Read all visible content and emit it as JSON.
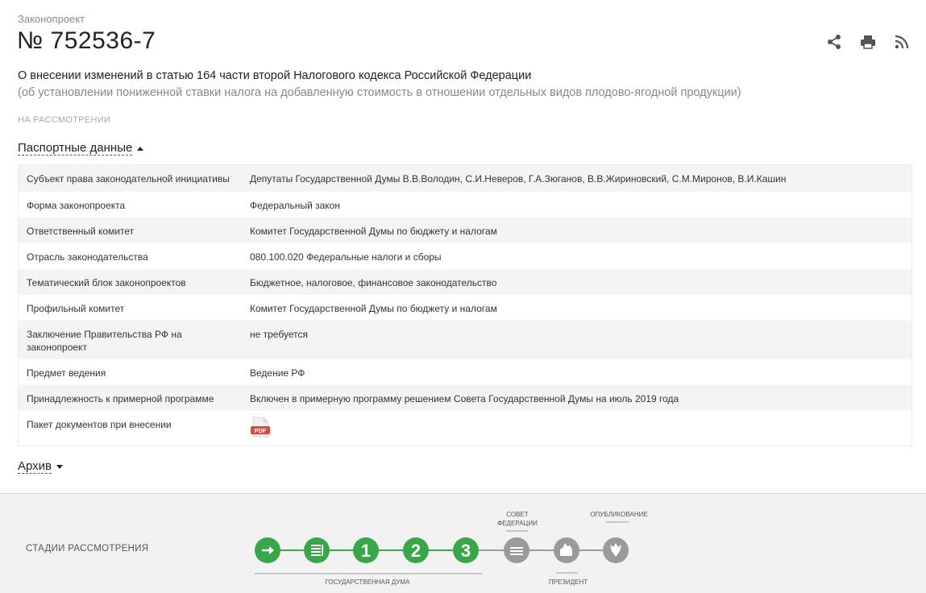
{
  "header": {
    "kicker": "Законопроект",
    "bill_number": "№ 752536-7",
    "actions": [
      {
        "name": "share-icon"
      },
      {
        "name": "print-icon"
      },
      {
        "name": "rss-icon"
      }
    ]
  },
  "bill": {
    "title": "О внесении изменений в статью 164 части второй Налогового кодекса Российской Федерации",
    "subtitle": "(об установлении пониженной ставки налога на добавленную стоимость в отношении отдельных видов плодово-ягодной продукции)",
    "status": "НА РАССМОТРЕНИИ"
  },
  "passport": {
    "toggle_label": "Паспортные данные",
    "rows": [
      {
        "key": "Субъект права законодательной инициативы",
        "value": "Депутаты Государственной Думы В.В.Володин, С.И.Неверов, Г.А.Зюганов, В.В.Жириновский, С.М.Миронов, В.И.Кашин"
      },
      {
        "key": "Форма законопроекта",
        "value": "Федеральный закон"
      },
      {
        "key": "Ответственный комитет",
        "value": "Комитет Государственной Думы по бюджету и налогам"
      },
      {
        "key": "Отрасль законодательства",
        "value": "080.100.020 Федеральные налоги и сборы"
      },
      {
        "key": "Тематический блок законопроектов",
        "value": "Бюджетное, налоговое, финансовое законодательство"
      },
      {
        "key": "Профильный комитет",
        "value": "Комитет Государственной Думы по бюджету и налогам"
      },
      {
        "key": "Заключение Правительства РФ на законопроект",
        "value": "не требуется"
      },
      {
        "key": "Предмет ведения",
        "value": "Ведение РФ"
      },
      {
        "key": "Принадлежность к примерной программе",
        "value": "Включен в примерную программу решением Совета Государственной Думы на июль 2019 года"
      },
      {
        "key": "Пакет документов при внесении",
        "value": ""
      }
    ],
    "pdf_label": "PDF"
  },
  "archive": {
    "toggle_label": "Архив"
  },
  "stages": {
    "title": "Стадии рассмотрения",
    "duma_label": "ГОСУДАРСТВЕННАЯ ДУМА",
    "federation_council_label_1": "СОВЕТ",
    "federation_council_label_2": "ФЕДЕРАЦИИ",
    "president_label": "ПРЕЗИДЕНТ",
    "publication_label": "ОПУБЛИКОВАНИЕ",
    "steps": [
      {
        "name": "stage-introduction",
        "label": "",
        "icon": "arrow-icon",
        "status": "done"
      },
      {
        "name": "stage-preliminary",
        "label": "",
        "icon": "document-icon",
        "status": "done"
      },
      {
        "name": "stage-first-reading",
        "label": "1",
        "icon": "",
        "status": "done"
      },
      {
        "name": "stage-second-reading",
        "label": "2",
        "icon": "",
        "status": "done"
      },
      {
        "name": "stage-third-reading",
        "label": "3",
        "icon": "",
        "status": "done"
      },
      {
        "name": "stage-federation-council",
        "label": "",
        "icon": "council-icon",
        "status": "pending"
      },
      {
        "name": "stage-president",
        "label": "",
        "icon": "president-icon",
        "status": "pending"
      },
      {
        "name": "stage-publication",
        "label": "",
        "icon": "emblem-icon",
        "status": "pending"
      }
    ],
    "colors": {
      "done": "#3aa64a",
      "pending": "#9a9a9a"
    }
  }
}
